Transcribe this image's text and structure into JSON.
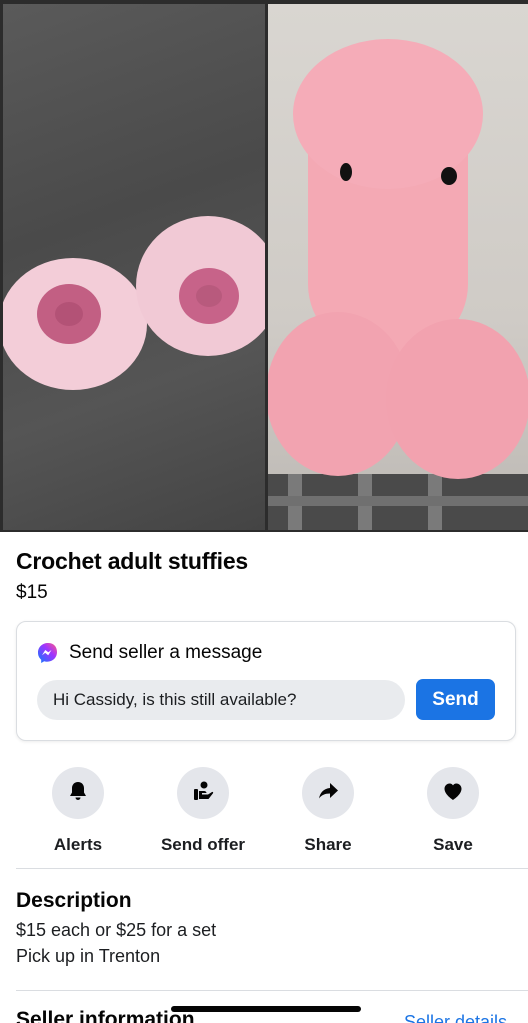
{
  "listing": {
    "title": "Crochet adult stuffies",
    "price": "$15"
  },
  "message": {
    "heading": "Send seller a message",
    "input_value": "Hi Cassidy, is this still available?",
    "send_label": "Send"
  },
  "actions": [
    {
      "label": "Alerts",
      "icon": "bell-icon"
    },
    {
      "label": "Send offer",
      "icon": "offer-hand-icon"
    },
    {
      "label": "Share",
      "icon": "share-arrow-icon"
    },
    {
      "label": "Save",
      "icon": "heart-icon"
    }
  ],
  "description": {
    "heading": "Description",
    "lines": [
      "$15 each or $25 for a set",
      "Pick up in Trenton"
    ]
  },
  "seller": {
    "heading": "Seller information",
    "details_link": "Seller details"
  },
  "colors": {
    "accent": "#1b74e4",
    "text": "#050505",
    "action_bg": "#e4e6eb",
    "input_bg": "#e9ebee"
  }
}
